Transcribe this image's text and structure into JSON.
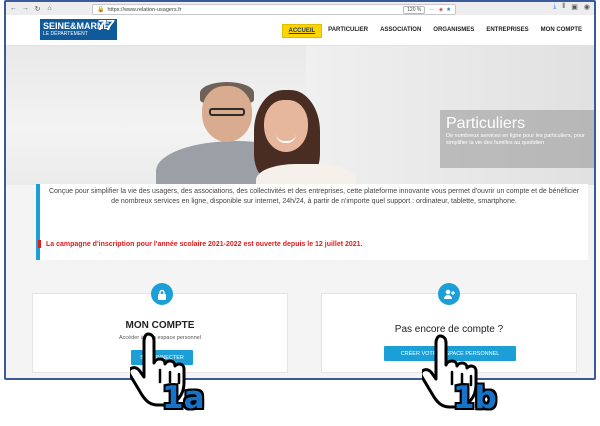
{
  "browser": {
    "url": "https://www.relation-usagers.fr",
    "zoom": "120 %",
    "icons": [
      "back-icon",
      "forward-icon",
      "reload-icon",
      "home-icon",
      "lock-icon",
      "pocket-icon",
      "bookmark-star-icon",
      "download-icon",
      "library-icon",
      "sidebar-icon",
      "account-icon"
    ]
  },
  "site": {
    "logo_line1": "SEINE&MARNE",
    "logo_line2": "LE DÉPARTEMENT",
    "logo_number": "77",
    "nav": [
      "ACCUEIL",
      "PARTICULIER",
      "ASSOCIATION",
      "ORGANISMES",
      "ENTREPRISES",
      "MON COMPTE"
    ],
    "active_nav": "ACCUEIL"
  },
  "hero": {
    "title": "Particuliers",
    "description": "De nombreux services en ligne pour les particuliers, pour simplifier la vie des familles au quotidien"
  },
  "intro": {
    "text": "Conçue pour simplifier la vie des usagers, des associations, des collectivités et des entreprises, cette plateforme innovante vous permet d'ouvrir un compte et de bénéficier de nombreux services en ligne, disponible sur internet, 24h/24, à partir de n'importe quel support : ordinateur, tablette, smartphone.",
    "campaign": "La campagne d'inscription pour l'année scolaire 2021-2022 est ouverte depuis le 12 juillet 2021."
  },
  "cards": {
    "account": {
      "title": "MON COMPTE",
      "description": "Accéder à mon espace personnel",
      "button": "SE CONNECTER"
    },
    "signup": {
      "title": "Pas encore de compte ?",
      "button": "CRÉER VOTRE ESPACE PERSONNEL"
    }
  },
  "annotations": {
    "step_a": "1a",
    "step_b": "1b"
  },
  "colors": {
    "brand_blue": "#1c9fd6",
    "nav_active": "#ffd400",
    "alert_red": "#e11b1b",
    "step_label": "#1673c8"
  }
}
